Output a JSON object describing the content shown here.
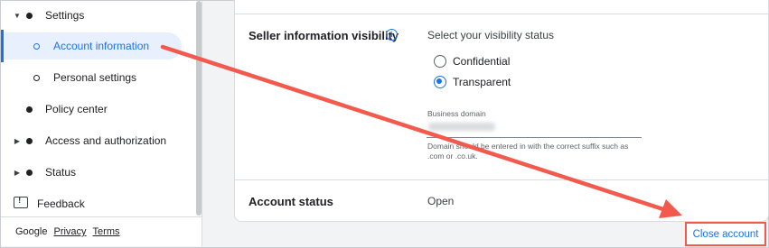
{
  "sidebar": {
    "items": [
      {
        "label": "Settings",
        "expander": "expanded"
      },
      {
        "label": "Account information",
        "active": true
      },
      {
        "label": "Personal settings"
      },
      {
        "label": "Policy center"
      },
      {
        "label": "Access and authorization",
        "expander": "collapsed"
      },
      {
        "label": "Status",
        "expander": "collapsed"
      },
      {
        "label": "Feedback",
        "icon": "feedback-icon"
      }
    ],
    "footer": {
      "brand": "Google",
      "privacy": "Privacy",
      "terms": "Terms"
    }
  },
  "main": {
    "seller_visibility": {
      "title": "Seller information visibility",
      "prompt": "Select your visibility status",
      "options": [
        {
          "label": "Confidential",
          "selected": false
        },
        {
          "label": "Transparent",
          "selected": true
        }
      ],
      "field_label": "Business domain",
      "helper_text": "Domain should be entered in with the correct suffix such as .com or .co.uk."
    },
    "account_status": {
      "title": "Account status",
      "value": "Open"
    },
    "close_account_label": "Close account"
  },
  "colors": {
    "accent": "#1a73e8",
    "annotation": "#f25a4e"
  }
}
